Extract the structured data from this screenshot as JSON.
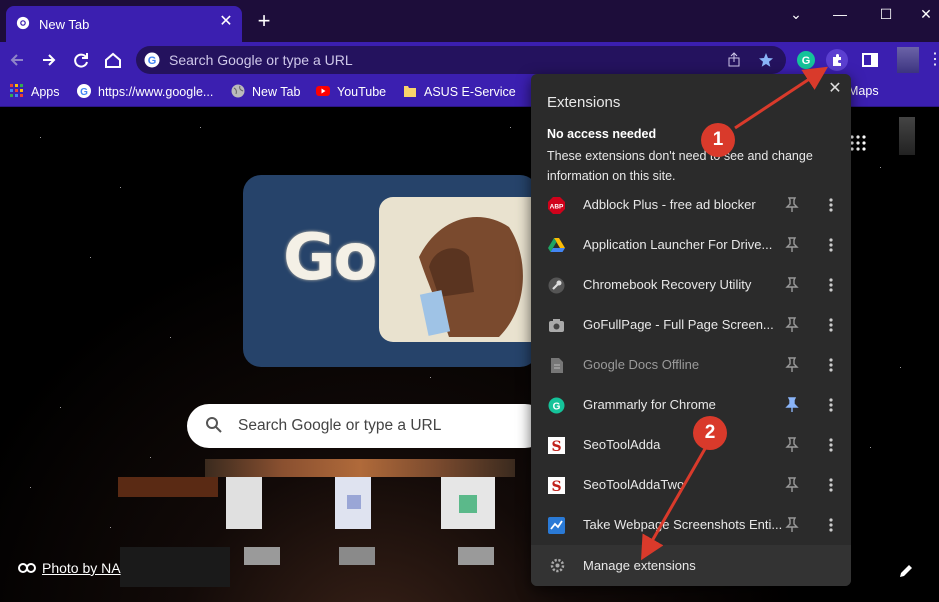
{
  "tab": {
    "title": "New Tab"
  },
  "window_controls": {
    "minimize": "—",
    "maximize": "☐",
    "close": "✕",
    "tab_list": "⌄"
  },
  "omnibox": {
    "placeholder": "Search Google or type a URL"
  },
  "bookmarks": [
    {
      "label": "Apps",
      "icon": "apps-grid-icon"
    },
    {
      "label": "https://www.google...",
      "icon": "google-icon"
    },
    {
      "label": "New Tab",
      "icon": "globe-icon"
    },
    {
      "label": "YouTube",
      "icon": "youtube-icon"
    },
    {
      "label": "ASUS E-Service",
      "icon": "folder-icon"
    },
    {
      "label": "Maps",
      "icon": "maps-icon"
    }
  ],
  "ntp": {
    "doodle_text": "Go",
    "search_placeholder": "Search Google or type a URL",
    "photo_credit": "Photo by NA"
  },
  "extensions_popup": {
    "title": "Extensions",
    "section_title": "No access needed",
    "section_desc": "These extensions don't need to see and change information on this site.",
    "items": [
      {
        "name": "Adblock Plus - free ad blocker",
        "icon": "abp-icon",
        "pinned": false,
        "dim": false
      },
      {
        "name": "Application Launcher For Drive...",
        "icon": "drive-icon",
        "pinned": false,
        "dim": false
      },
      {
        "name": "Chromebook Recovery Utility",
        "icon": "recovery-icon",
        "pinned": false,
        "dim": false
      },
      {
        "name": "GoFullPage - Full Page Screen...",
        "icon": "camera-icon",
        "pinned": false,
        "dim": false
      },
      {
        "name": "Google Docs Offline",
        "icon": "docs-icon",
        "pinned": false,
        "dim": true
      },
      {
        "name": "Grammarly for Chrome",
        "icon": "grammarly-icon",
        "pinned": true,
        "dim": false
      },
      {
        "name": "SeoToolAdda",
        "icon": "seo-icon",
        "pinned": false,
        "dim": false
      },
      {
        "name": "SeoToolAddaTwo",
        "icon": "seo-icon",
        "pinned": false,
        "dim": false
      },
      {
        "name": "Take Webpage Screenshots Enti...",
        "icon": "screenshot-icon",
        "pinned": false,
        "dim": false
      }
    ],
    "manage_label": "Manage extensions"
  },
  "annotations": [
    {
      "label": "1"
    },
    {
      "label": "2"
    }
  ],
  "colors": {
    "accent": "#3b1fb0",
    "popup_bg": "#2b2b2b",
    "pin_active": "#8ab4f8",
    "annotation": "#d93a2b"
  }
}
